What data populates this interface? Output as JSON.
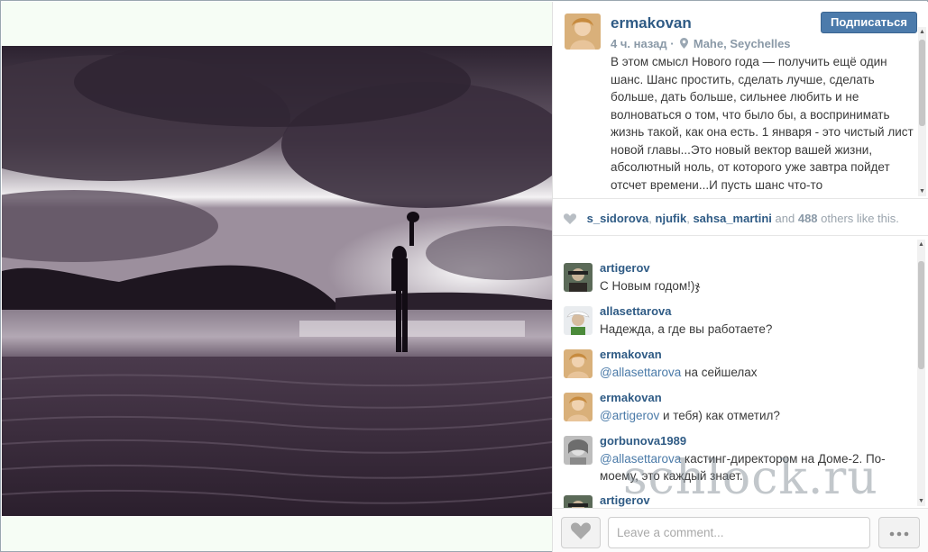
{
  "post": {
    "username": "ermakovan",
    "time": "4 ч. назад",
    "separator": "·",
    "location": "Mahe, Seychelles",
    "follow_label": "Подписаться",
    "caption": "В этом смысл Нового года — получить ещё один шанс. Шанс простить, сделать лучше, сделать больше, дать больше, сильнее любить и не волноваться о том, что было бы, а воспринимать жизнь такой, как она есть. 1 января - это чистый лист новой главы...Это новый вектор вашей жизни, абсолютный ноль, от которого уже завтра пойдет отсчет времени...И пусть шанс что-то"
  },
  "likes": {
    "user1": "s_sidorova",
    "sep1": ",",
    "user2": "njufik",
    "sep2": ",",
    "user3": "sahsa_martini",
    "and": "and",
    "count": "488",
    "rest": "others like this."
  },
  "comments": [
    {
      "user": "artigerov",
      "mention": "",
      "text": "С Новым годом!)ჯ"
    },
    {
      "user": "allasettarova",
      "mention": "",
      "text": "Надежда, а где вы работаете?"
    },
    {
      "user": "ermakovan",
      "mention": "@allasettarova",
      "text": " на сейшелах"
    },
    {
      "user": "ermakovan",
      "mention": "@artigerov",
      "text": " и тебя) как отметил?"
    },
    {
      "user": "gorbunova1989",
      "mention": "@allasettarova",
      "text": " кастинг-директором на Доме-2. По-моему, это каждый знает."
    },
    {
      "user": "artigerov",
      "mention": "",
      "text": ""
    }
  ],
  "footer": {
    "comment_placeholder": "Leave a comment..."
  },
  "icons": {
    "heart": "heart-icon",
    "pin": "location-pin-icon",
    "more": "more-dots-icon"
  },
  "watermark": "schlock.ru"
}
